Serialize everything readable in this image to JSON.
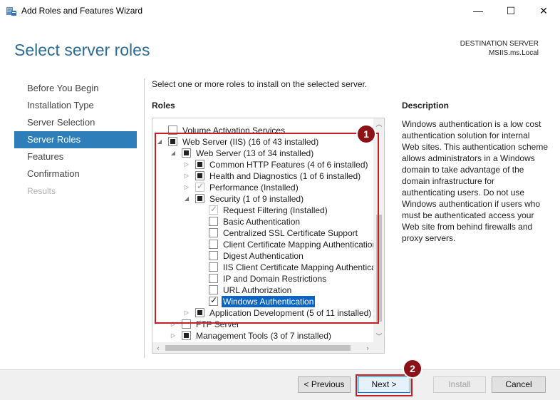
{
  "window": {
    "title": "Add Roles and Features Wizard",
    "minimize": "—",
    "maximize": "☐",
    "close": "✕"
  },
  "page": {
    "heading": "Select server roles",
    "destination_label": "DESTINATION SERVER",
    "destination_name": "MSIIS.ms.Local"
  },
  "nav": {
    "items": [
      {
        "label": "Before You Begin"
      },
      {
        "label": "Installation Type"
      },
      {
        "label": "Server Selection"
      },
      {
        "label": "Server Roles"
      },
      {
        "label": "Features"
      },
      {
        "label": "Confirmation"
      },
      {
        "label": "Results"
      }
    ]
  },
  "intro": "Select one or more roles to install on the selected server.",
  "roles_label": "Roles",
  "tree": {
    "rows": [
      {
        "label": "Volume Activation Services"
      },
      {
        "label": "Web Server (IIS) (16 of 43 installed)"
      },
      {
        "label": "Web Server (13 of 34 installed)"
      },
      {
        "label": "Common HTTP Features (4 of 6 installed)"
      },
      {
        "label": "Health and Diagnostics (1 of 6 installed)"
      },
      {
        "label": "Performance (Installed)"
      },
      {
        "label": "Security (1 of 9 installed)"
      },
      {
        "label": "Request Filtering (Installed)"
      },
      {
        "label": "Basic Authentication"
      },
      {
        "label": "Centralized SSL Certificate Support"
      },
      {
        "label": "Client Certificate Mapping Authentication"
      },
      {
        "label": "Digest Authentication"
      },
      {
        "label": "IIS Client Certificate Mapping Authentication"
      },
      {
        "label": "IP and Domain Restrictions"
      },
      {
        "label": "URL Authorization"
      },
      {
        "label": "Windows Authentication"
      },
      {
        "label": "Application Development (5 of 11 installed)"
      },
      {
        "label": "FTP Server"
      },
      {
        "label": "Management Tools (3 of 7 installed)"
      }
    ]
  },
  "description": {
    "label": "Description",
    "text": "Windows authentication is a low cost authentication solution for internal Web sites. This authentication scheme allows administrators in a Windows domain to take advantage of the domain infrastructure for authenticating users. Do not use Windows authentication if users who must be authenticated access your Web site from behind firewalls and proxy servers."
  },
  "annotations": {
    "badge1": "1",
    "badge2": "2"
  },
  "buttons": {
    "previous": "< Previous",
    "next": "Next >",
    "install": "Install",
    "cancel": "Cancel"
  },
  "colors": {
    "accent": "#2e7fb9",
    "heading": "#2b6c96",
    "highlight": "#c42026",
    "badge": "#8b1317",
    "selection": "#0a64c4"
  }
}
